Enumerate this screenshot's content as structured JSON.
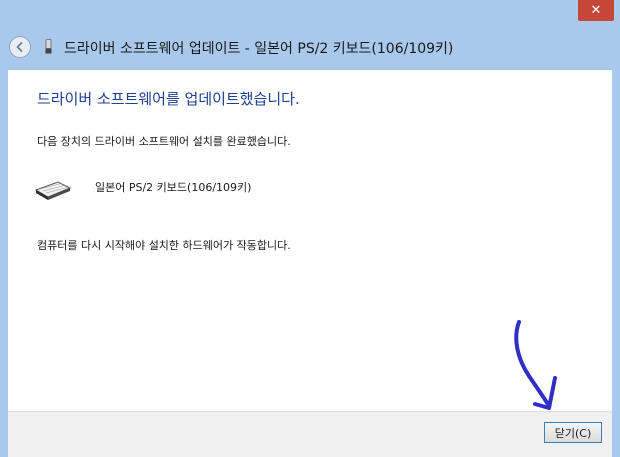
{
  "window": {
    "close_glyph": "✕",
    "header_title": "드라이버 소프트웨어 업데이트 - 일본어 PS/2 키보드(106/109키)"
  },
  "content": {
    "main_title": "드라이버 소프트웨어를 업데이트했습니다.",
    "description": "다음 장치의 드라이버 소프트웨어 설치를 완료했습니다.",
    "device_name": "일본어 PS/2 키보드(106/109키)",
    "restart_message": "컴퓨터를 다시 시작해야 설치한 하드웨어가 작동합니다."
  },
  "footer": {
    "close_button_label": "닫기(C)"
  },
  "icons": {
    "back": "back-arrow-icon",
    "device_small": "device-icon",
    "keyboard": "keyboard-icon",
    "close": "close-icon",
    "annotation": "arrow-annotation"
  },
  "colors": {
    "frame": "#a9c9ee",
    "title_blue": "#1f3f8f",
    "close_red": "#c7463a",
    "annotation_blue": "#2f2fc8"
  }
}
